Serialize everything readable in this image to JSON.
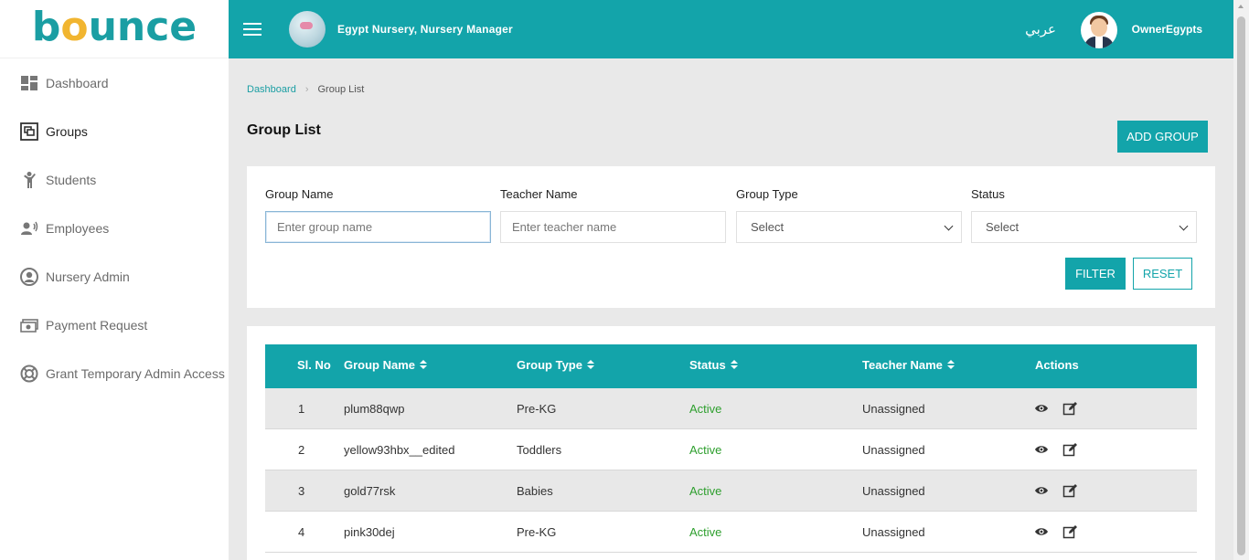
{
  "brand": {
    "logo_text_a": "b",
    "logo_text_dot": "o",
    "logo_text_b": "unce"
  },
  "sidebar": {
    "items": [
      {
        "label": "Dashboard",
        "icon": "dashboard-icon"
      },
      {
        "label": "Groups",
        "icon": "groups-icon"
      },
      {
        "label": "Students",
        "icon": "student-icon"
      },
      {
        "label": "Employees",
        "icon": "employee-icon"
      },
      {
        "label": "Nursery Admin",
        "icon": "user-circle-icon"
      },
      {
        "label": "Payment Request",
        "icon": "money-icon"
      },
      {
        "label": "Grant Temporary Admin Access",
        "icon": "lifebuoy-icon"
      }
    ]
  },
  "header": {
    "nursery_title": "Egypt Nursery, Nursery Manager",
    "language_toggle": "عربي",
    "user_name": "OwnerEgypts",
    "accent_color": "#13a4aa"
  },
  "breadcrumb": {
    "home": "Dashboard",
    "current": "Group List"
  },
  "page": {
    "title": "Group List",
    "add_button": "ADD GROUP"
  },
  "filters": {
    "group_name_label": "Group Name",
    "group_name_placeholder": "Enter group name",
    "teacher_name_label": "Teacher Name",
    "teacher_name_placeholder": "Enter teacher name",
    "group_type_label": "Group Type",
    "group_type_value": "Select",
    "status_label": "Status",
    "status_value": "Select",
    "filter_button": "FILTER",
    "reset_button": "RESET"
  },
  "table": {
    "headers": [
      "Sl. No",
      "Group Name",
      "Group Type",
      "Status",
      "Teacher Name",
      "Actions"
    ],
    "rows": [
      {
        "sl": "1",
        "group_name": "plum88qwp",
        "group_type": "Pre-KG",
        "status": "Active",
        "teacher": "Unassigned"
      },
      {
        "sl": "2",
        "group_name": "yellow93hbx__edited",
        "group_type": "Toddlers",
        "status": "Active",
        "teacher": "Unassigned"
      },
      {
        "sl": "3",
        "group_name": "gold77rsk",
        "group_type": "Babies",
        "status": "Active",
        "teacher": "Unassigned"
      },
      {
        "sl": "4",
        "group_name": "pink30dej",
        "group_type": "Pre-KG",
        "status": "Active",
        "teacher": "Unassigned"
      }
    ],
    "status_color": "#2e9f2e"
  }
}
